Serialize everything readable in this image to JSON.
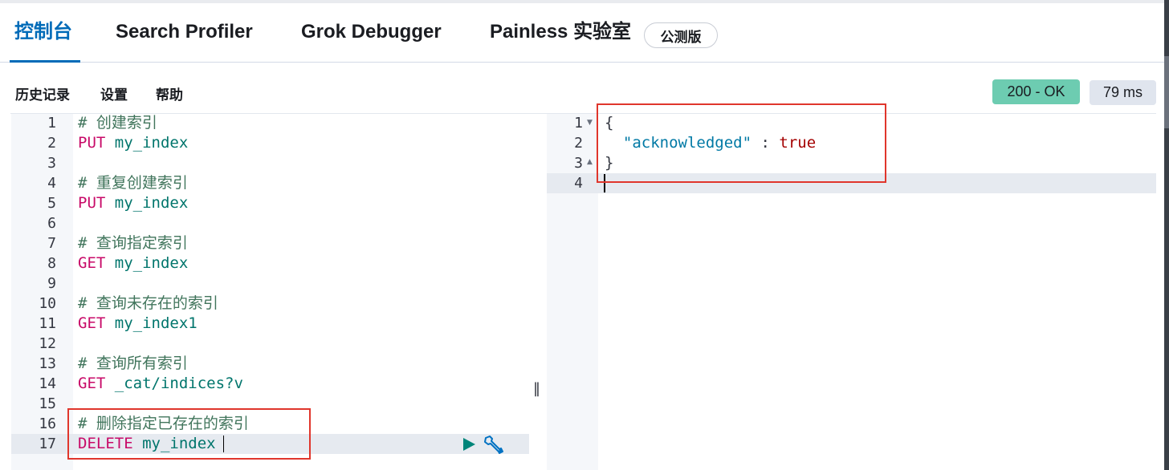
{
  "tabs": [
    {
      "label": "控制台"
    },
    {
      "label": "Search Profiler"
    },
    {
      "label": "Grok Debugger"
    },
    {
      "label": "Painless 实验室",
      "badge": "公测版"
    }
  ],
  "toolbar": {
    "history": "历史记录",
    "settings": "设置",
    "help": "帮助",
    "status": "200 - OK",
    "time": "79 ms"
  },
  "request_editor": {
    "lines": [
      {
        "n": "1",
        "comment": "# 创建索引"
      },
      {
        "n": "2",
        "method": "PUT",
        "path": "my_index"
      },
      {
        "n": "3"
      },
      {
        "n": "4",
        "comment": "# 重复创建索引"
      },
      {
        "n": "5",
        "method": "PUT",
        "path": "my_index"
      },
      {
        "n": "6"
      },
      {
        "n": "7",
        "comment": "# 查询指定索引"
      },
      {
        "n": "8",
        "method": "GET",
        "path": "my_index"
      },
      {
        "n": "9"
      },
      {
        "n": "10",
        "comment": "# 查询未存在的索引"
      },
      {
        "n": "11",
        "method": "GET",
        "path": "my_index1"
      },
      {
        "n": "12"
      },
      {
        "n": "13",
        "comment": "# 查询所有索引"
      },
      {
        "n": "14",
        "method": "GET",
        "path": "_cat/indices?v"
      },
      {
        "n": "15"
      },
      {
        "n": "16",
        "comment": "# 删除指定已存在的索引"
      },
      {
        "n": "17",
        "method": "DELETE",
        "path": "my_index"
      }
    ]
  },
  "response_editor": {
    "line_numbers": [
      "1",
      "2",
      "3",
      "4"
    ],
    "open_brace": "{",
    "key": "\"acknowledged\"",
    "colon": " : ",
    "value": "true",
    "close_brace": "}"
  },
  "icons": {
    "run": "play-icon",
    "wrench": "wrench-icon",
    "resize": "resize-handle-icon"
  },
  "colors": {
    "accent": "#006bb8",
    "status_ok": "#6dccb1",
    "highlight_box": "#e0362c"
  }
}
